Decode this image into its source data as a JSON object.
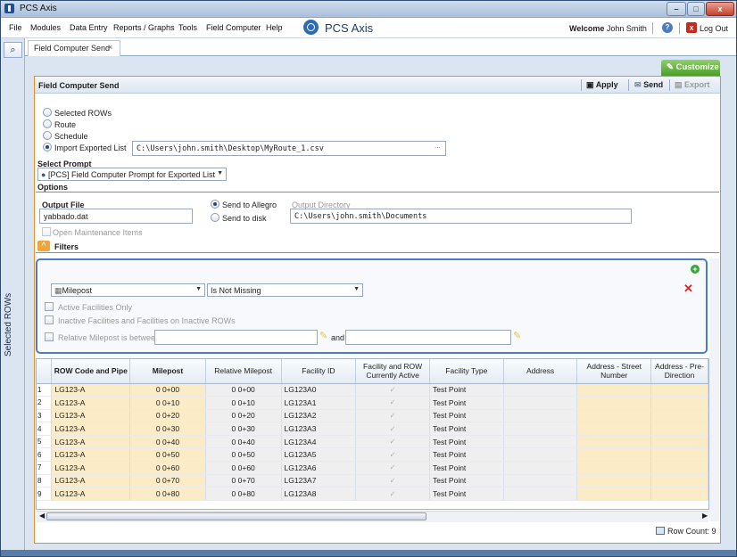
{
  "window": {
    "title": "PCS Axis",
    "min": "–",
    "max": "□",
    "close": "x"
  },
  "menu": [
    "File",
    "Modules",
    "Data Entry",
    "Reports / Graphs",
    "Tools",
    "Field Computer",
    "Help"
  ],
  "logo_text": "PCS Axis",
  "welcome": {
    "prefix": "Welcome",
    "user": "John Smith"
  },
  "logout": "Log Out",
  "left_panel_label": "Selected ROWs",
  "tab": {
    "label": "Field Computer Send",
    "close": "×"
  },
  "customize": "Customize",
  "panel": {
    "title": "Field Computer Send",
    "apply": "Apply",
    "send": "Send",
    "export": "Export"
  },
  "source_options": [
    {
      "label": "Selected ROWs",
      "selected": false
    },
    {
      "label": "Route",
      "selected": false
    },
    {
      "label": "Schedule",
      "selected": false
    },
    {
      "label": "Import Exported List",
      "selected": true
    }
  ],
  "import_path": "C:\\Users\\john.smith\\Desktop\\MyRoute_1.csv",
  "browse": "...",
  "select_prompt": {
    "label": "Select Prompt",
    "value": "[PCS] Field Computer Prompt for Exported List"
  },
  "options": {
    "title": "Options",
    "output_file_label": "Output File",
    "output_file": "yabbado.dat",
    "send_allegro": "Send to Allegro",
    "send_disk": "Send to disk",
    "output_dir_label": "Output Directory",
    "output_dir": "C:\\Users\\john.smith\\Documents",
    "open_maint": "Open Maintenance Items"
  },
  "filters": {
    "title": "Filters",
    "field": "Milepost",
    "condition": "Is Not Missing",
    "active_only": "Active Facilities Only",
    "inactive": "Inactive Facilities and Facilities on Inactive ROWs",
    "relative_between": "Relative Milepost is between",
    "and": "and"
  },
  "grid": {
    "columns": [
      "ROW Code and Pipe",
      "Milepost",
      "Relative Milepost",
      "Facility ID",
      "Facility and ROW Currently Active",
      "Facility Type",
      "Address",
      "Address - Street Number",
      "Address - Pre-Direction"
    ],
    "rows": [
      {
        "n": "1",
        "row": "LG123-A",
        "mp": "0  0+00",
        "rmp": "0  0+00",
        "fid": "LG123A0",
        "type": "Test Point"
      },
      {
        "n": "2",
        "row": "LG123-A",
        "mp": "0  0+10",
        "rmp": "0  0+10",
        "fid": "LG123A1",
        "type": "Test Point"
      },
      {
        "n": "3",
        "row": "LG123-A",
        "mp": "0  0+20",
        "rmp": "0  0+20",
        "fid": "LG123A2",
        "type": "Test Point"
      },
      {
        "n": "4",
        "row": "LG123-A",
        "mp": "0  0+30",
        "rmp": "0  0+30",
        "fid": "LG123A3",
        "type": "Test Point"
      },
      {
        "n": "5",
        "row": "LG123-A",
        "mp": "0  0+40",
        "rmp": "0  0+40",
        "fid": "LG123A4",
        "type": "Test Point"
      },
      {
        "n": "6",
        "row": "LG123-A",
        "mp": "0  0+50",
        "rmp": "0  0+50",
        "fid": "LG123A5",
        "type": "Test Point"
      },
      {
        "n": "7",
        "row": "LG123-A",
        "mp": "0  0+60",
        "rmp": "0  0+60",
        "fid": "LG123A6",
        "type": "Test Point"
      },
      {
        "n": "8",
        "row": "LG123-A",
        "mp": "0  0+70",
        "rmp": "0  0+70",
        "fid": "LG123A7",
        "type": "Test Point"
      },
      {
        "n": "9",
        "row": "LG123-A",
        "mp": "0  0+80",
        "rmp": "0  0+80",
        "fid": "LG123A8",
        "type": "Test Point"
      }
    ]
  },
  "row_count": "Row Count: 9",
  "colors": {
    "accent": "#e3902a",
    "green": "#6dab45",
    "blue": "#4a7dc9",
    "row_highlight": "#fbebc6"
  }
}
